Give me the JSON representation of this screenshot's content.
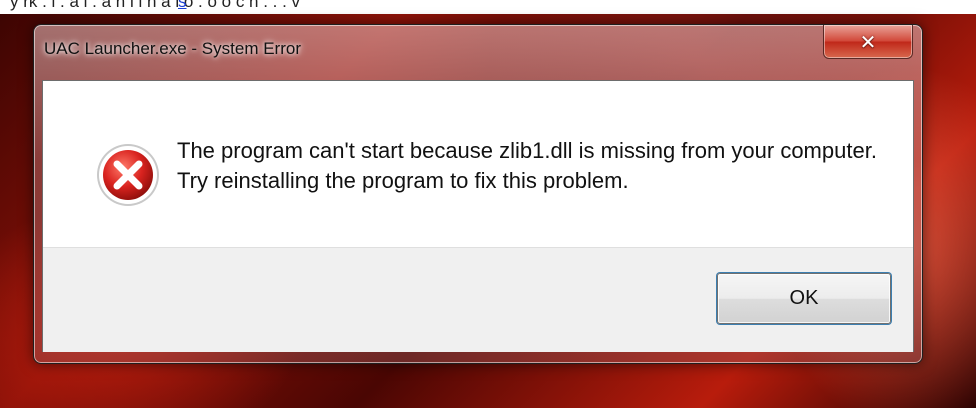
{
  "background_page": {
    "visible_text_fragment": "y rk . l . a l . a h i i h a i o . o o c h . . . v",
    "link_fragment": "s"
  },
  "window": {
    "title": "UAC Launcher.exe - System Error",
    "close_glyph": "✕"
  },
  "dialog": {
    "icon": "error-icon",
    "message": "The program can't start because zlib1.dll is missing from your computer. Try reinstalling the program to fix this problem.",
    "ok_label": "OK"
  },
  "colors": {
    "close_button": "#c7382a",
    "error_icon": "#d9231f",
    "button_bar": "#f0f0f0",
    "focus_ring": "#3c7fb1"
  }
}
